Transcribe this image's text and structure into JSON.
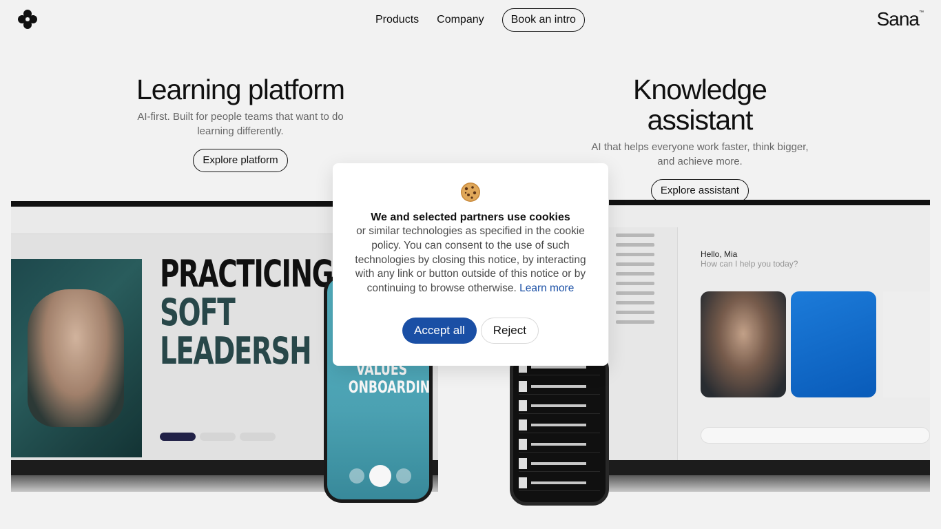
{
  "header": {
    "logo_icon": "sana-flower-logo-icon",
    "nav": {
      "products": "Products",
      "company": "Company",
      "book_intro": "Book an intro"
    },
    "wordmark": "Sana",
    "wordmark_tm": "™"
  },
  "sections": {
    "learning": {
      "title": "Learning platform",
      "description": "AI-first. Built for people teams that want to do learning differently.",
      "cta": "Explore platform"
    },
    "assistant": {
      "title": "Knowledge assistant",
      "description": "AI that helps everyone work faster, think bigger, and achieve more.",
      "cta": "Explore assistant"
    }
  },
  "hero_mockup": {
    "slide_title_line1": "PRACTICING",
    "slide_title_line2": "SOFT",
    "slide_title_line3": "LEADERSH",
    "phone_title_line1": "VALUES",
    "phone_title_line2": "ONBOARDING",
    "greeting": "Hello, Mia",
    "greeting_sub": "How can I help you today?"
  },
  "cookie_banner": {
    "icon": "cookie-icon",
    "title": "We and selected partners use cookies",
    "body": "or similar technologies as specified in the cookie policy. You can consent to the use of such technologies by closing this notice, by interacting with any link or button outside of this notice or by continuing to browse otherwise.",
    "learn_more": "Learn more",
    "accept": "Accept all",
    "reject": "Reject",
    "accent_color": "#1a4fa5"
  }
}
